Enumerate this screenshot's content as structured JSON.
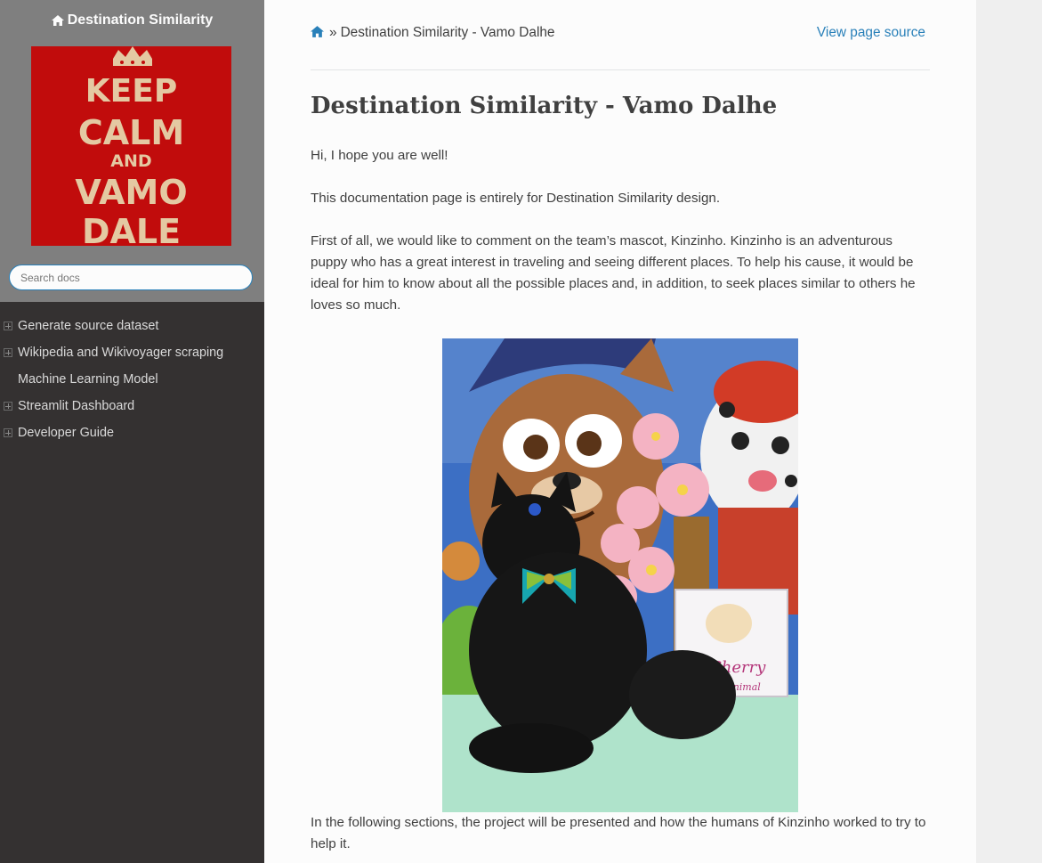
{
  "sidebar": {
    "project_title": "Destination Similarity",
    "logo_lines": [
      "KEEP",
      "CALM",
      "AND",
      "VAMO",
      "DALE"
    ],
    "search_placeholder": "Search docs",
    "nav": [
      {
        "label": "Generate source dataset",
        "expandable": true
      },
      {
        "label": "Wikipedia and Wikivoyager scraping",
        "expandable": true
      },
      {
        "label": "Machine Learning Model",
        "expandable": false
      },
      {
        "label": "Streamlit Dashboard",
        "expandable": true
      },
      {
        "label": "Developer Guide",
        "expandable": true
      }
    ]
  },
  "breadcrumb": {
    "separator": "»",
    "current": "Destination Similarity - Vamo Dalhe",
    "view_source": "View page source"
  },
  "page": {
    "title": "Destination Similarity - Vamo Dalhe",
    "paragraphs": [
      "Hi, I hope you are well!",
      "This documentation page is entirely for Destination Similarity design.",
      "First of all, we would like to comment on the team’s mascot, Kinzinho. Kinzinho is an adventurous puppy who has a great interest in traveling and seeing different places. To help his cause, it would be ideal for him to know about all the possible places and, in addition, to seek places similar to others he loves so much.",
      "In the following sections, the project will be presented and how the humans of Kinzinho worked to try to help it."
    ],
    "photo_card_text": [
      "Cherry",
      "pet's animal"
    ]
  },
  "colors": {
    "sidebar_dark": "#343131",
    "sidebar_top": "#7f7f7f",
    "link": "#2980b9",
    "logo_red": "#c10c0c",
    "logo_text": "#e4c9a2"
  }
}
